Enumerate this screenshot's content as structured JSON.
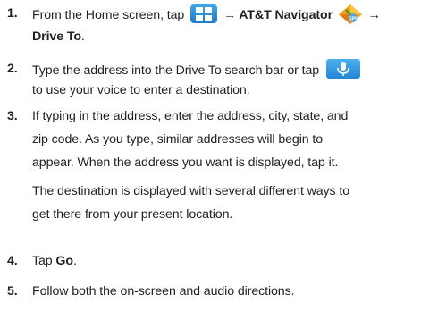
{
  "steps": [
    {
      "number": "1.",
      "lines": {
        "l1_a": "From the Home screen, tap",
        "l1_b": "→ AT&T Navigator",
        "l1_c": "→",
        "l2_bold": "Drive To",
        "l2_end": "."
      },
      "icons": [
        "apps-grid-icon",
        "att-navigator-gps-icon"
      ]
    },
    {
      "number": "2.",
      "lines": {
        "l1": "Type the address into the Drive To search bar or tap",
        "l2": "to use your voice to enter a destination."
      },
      "icons": [
        "microphone-icon"
      ]
    },
    {
      "number": "3.",
      "lines": {
        "l1": "If typing in the address, enter the address, city, state, and",
        "l2": "zip code. As you type, similar addresses will begin to",
        "l3": "appear. When the address you want is displayed, tap it.",
        "l4": "The destination is displayed with several different ways to",
        "l5": "get there from your present location."
      }
    },
    {
      "number": "4.",
      "lines": {
        "l1_a": "Tap ",
        "l1_bold": "Go",
        "l1_end": "."
      }
    },
    {
      "number": "5.",
      "lines": {
        "l1": "Follow both the on-screen and audio directions."
      }
    }
  ],
  "colors": {
    "text": "#231f20",
    "icon_blue": "#2a8ad8"
  }
}
